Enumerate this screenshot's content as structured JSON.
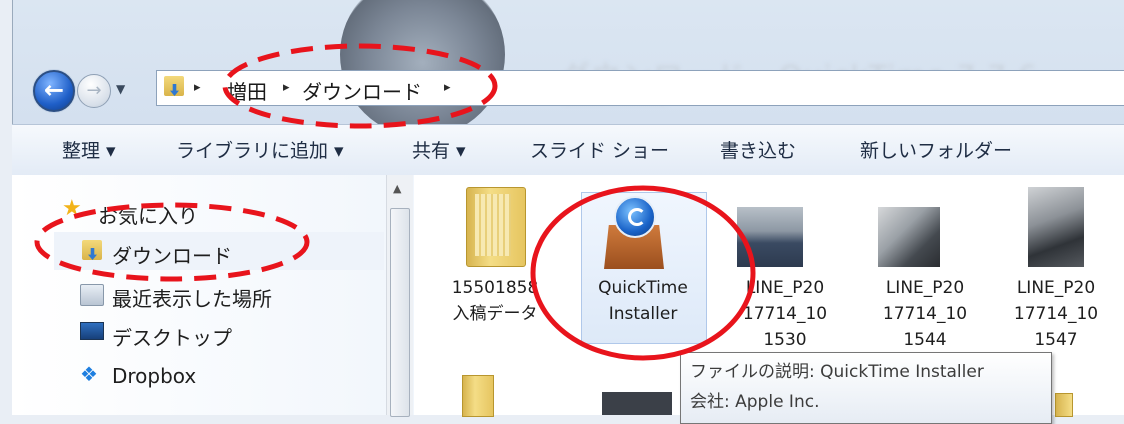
{
  "window": {
    "title_blurred": "ダウンロード - QuickTime 7.7.6"
  },
  "address_bar": {
    "crumbs": [
      "増田",
      "ダウンロード"
    ],
    "separator": "▸"
  },
  "toolbar": {
    "organize": "整理 ▾",
    "add_to_library": "ライブラリに追加 ▾",
    "share": "共有 ▾",
    "slideshow": "スライド ショー",
    "burn": "書き込む",
    "new_folder": "新しいフォルダー"
  },
  "nav_pane": {
    "favorites": "お気に入り",
    "downloads": "ダウンロード",
    "recent": "最近表示した場所",
    "desktop": "デスクトップ",
    "dropbox": "Dropbox"
  },
  "files": [
    {
      "line1": "15501858",
      "line2": "入稿データ"
    },
    {
      "line1": "QuickTime",
      "line2": "Installer"
    },
    {
      "line1": "LINE_P20",
      "line2": "17714_10",
      "line3": "1530"
    },
    {
      "line1": "LINE_P20",
      "line2": "17714_10",
      "line3": "1544"
    },
    {
      "line1": "LINE_P20",
      "line2": "17714_10",
      "line3": "1547"
    }
  ],
  "tooltip": {
    "description": "ファイルの説明: QuickTime Installer",
    "company": "会社: Apple Inc."
  },
  "colors": {
    "annotation_red": "#e8141c",
    "selection_blue": "#dde9f8"
  }
}
